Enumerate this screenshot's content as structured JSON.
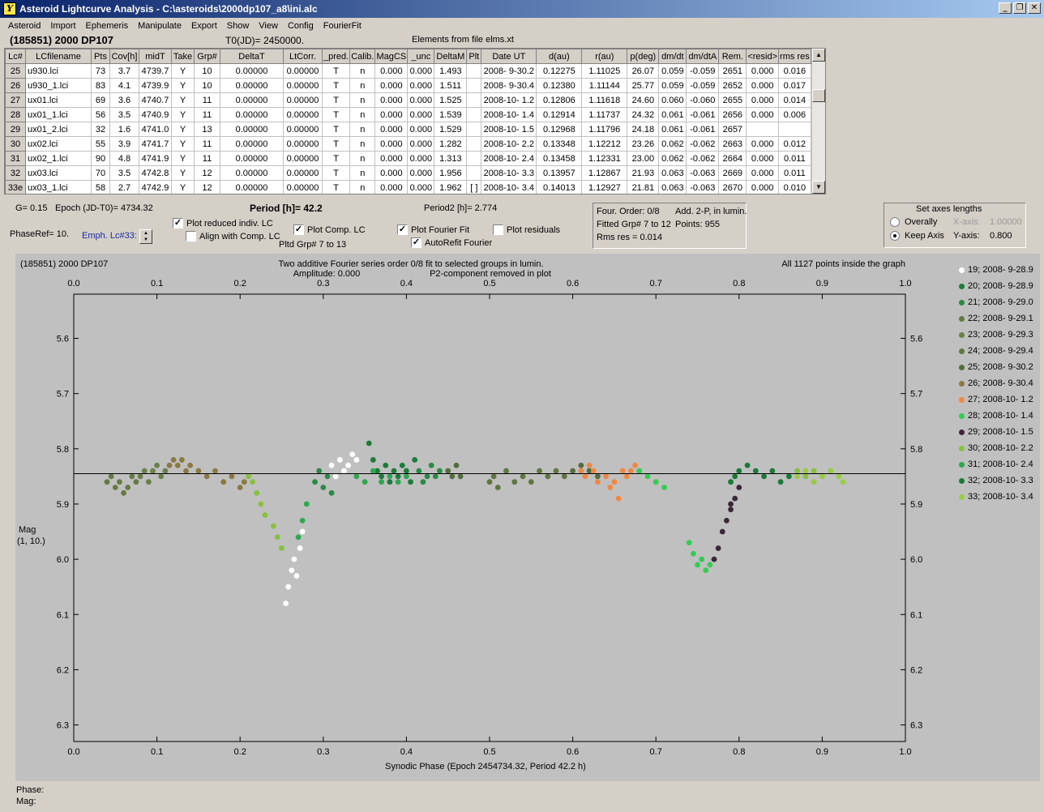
{
  "window": {
    "title": "Asteroid Lightcurve Analysis - C:\\asteroids\\2000dp107_a8\\ini.alc",
    "min_label": "_",
    "restore_label": "❐",
    "close_label": "✕"
  },
  "menu": [
    "Asteroid",
    "Import",
    "Ephemeris",
    "Manipulate",
    "Export",
    "Show",
    "View",
    "Config",
    "FourierFit"
  ],
  "header": {
    "object": "(185851) 2000 DP107",
    "t0": "T0(JD)= 2450000.",
    "elements": "Elements from file elms.xt"
  },
  "table": {
    "columns": [
      "Lc#",
      "LCfilename",
      "Pts",
      "Cov[h]",
      "midT",
      "Take",
      "Grp#",
      "DeltaT",
      "LtCorr.",
      "_pred.",
      "Calib.",
      "MagCS",
      "_unc",
      "DeltaM",
      "Plt",
      "Date UT",
      "d(au)",
      "r(au)",
      "p(deg)",
      "dm/dt",
      "dm/dtA",
      "Rem.",
      "<resid>",
      "rms res"
    ],
    "rows": [
      [
        "25",
        "u930.lci",
        "73",
        "3.7",
        "4739.7",
        "Y",
        "10",
        "0.00000",
        "0.00000",
        "T",
        "n",
        "0.000",
        "0.000",
        "1.493",
        "",
        "2008- 9-30.2",
        "0.12275",
        "1.11025",
        "26.07",
        "0.059",
        "-0.059",
        "2651",
        "0.000",
        "0.016"
      ],
      [
        "26",
        "u930_1.lci",
        "83",
        "4.1",
        "4739.9",
        "Y",
        "10",
        "0.00000",
        "0.00000",
        "T",
        "n",
        "0.000",
        "0.000",
        "1.511",
        "",
        "2008- 9-30.4",
        "0.12380",
        "1.11144",
        "25.77",
        "0.059",
        "-0.059",
        "2652",
        "0.000",
        "0.017"
      ],
      [
        "27",
        "ux01.lci",
        "69",
        "3.6",
        "4740.7",
        "Y",
        "11",
        "0.00000",
        "0.00000",
        "T",
        "n",
        "0.000",
        "0.000",
        "1.525",
        "",
        "2008-10- 1.2",
        "0.12806",
        "1.11618",
        "24.60",
        "0.060",
        "-0.060",
        "2655",
        "0.000",
        "0.014"
      ],
      [
        "28",
        "ux01_1.lci",
        "56",
        "3.5",
        "4740.9",
        "Y",
        "11",
        "0.00000",
        "0.00000",
        "T",
        "n",
        "0.000",
        "0.000",
        "1.539",
        "",
        "2008-10- 1.4",
        "0.12914",
        "1.11737",
        "24.32",
        "0.061",
        "-0.061",
        "2656",
        "0.000",
        "0.006"
      ],
      [
        "29",
        "ux01_2.lci",
        "32",
        "1.6",
        "4741.0",
        "Y",
        "13",
        "0.00000",
        "0.00000",
        "T",
        "n",
        "0.000",
        "0.000",
        "1.529",
        "",
        "2008-10- 1.5",
        "0.12968",
        "1.11796",
        "24.18",
        "0.061",
        "-0.061",
        "2657",
        "",
        ""
      ],
      [
        "30",
        "ux02.lci",
        "55",
        "3.9",
        "4741.7",
        "Y",
        "11",
        "0.00000",
        "0.00000",
        "T",
        "n",
        "0.000",
        "0.000",
        "1.282",
        "",
        "2008-10- 2.2",
        "0.13348",
        "1.12212",
        "23.26",
        "0.062",
        "-0.062",
        "2663",
        "0.000",
        "0.012"
      ],
      [
        "31",
        "ux02_1.lci",
        "90",
        "4.8",
        "4741.9",
        "Y",
        "11",
        "0.00000",
        "0.00000",
        "T",
        "n",
        "0.000",
        "0.000",
        "1.313",
        "",
        "2008-10- 2.4",
        "0.13458",
        "1.12331",
        "23.00",
        "0.062",
        "-0.062",
        "2664",
        "0.000",
        "0.011"
      ],
      [
        "32",
        "ux03.lci",
        "70",
        "3.5",
        "4742.8",
        "Y",
        "12",
        "0.00000",
        "0.00000",
        "T",
        "n",
        "0.000",
        "0.000",
        "1.956",
        "",
        "2008-10- 3.3",
        "0.13957",
        "1.12867",
        "21.93",
        "0.063",
        "-0.063",
        "2669",
        "0.000",
        "0.011"
      ],
      [
        "33e",
        "ux03_1.lci",
        "58",
        "2.7",
        "4742.9",
        "Y",
        "12",
        "0.00000",
        "0.00000",
        "T",
        "n",
        "0.000",
        "0.000",
        "1.962",
        "[ ]",
        "2008-10- 3.4",
        "0.14013",
        "1.12927",
        "21.81",
        "0.063",
        "-0.063",
        "2670",
        "0.000",
        "0.010"
      ]
    ]
  },
  "controls": {
    "g": "G= 0.15",
    "epoch": "Epoch (JD-T0)= 4734.32",
    "period": "Period [h]= 42.2",
    "period2": "Period2 [h]= 2.774",
    "phaseref": "PhaseRef= 10.",
    "emph": "Emph. Lc#33:",
    "plot_reduced": "Plot reduced indiv. LC",
    "align_comp": "Align with Comp. LC",
    "plot_comp": "Plot Comp. LC",
    "pltd_grp": "Pltd Grp#  7   to   13",
    "plot_fourier": "Plot Fourier Fit",
    "autorefit": "AutoRefit Fourier",
    "plot_residuals": "Plot residuals",
    "checked_mark": "✓",
    "four_order": "Four. Order:   0/8",
    "add_2p": "Add. 2-P, in lumin.",
    "fitted_grp": "Fitted Grp# 7 to 12",
    "points": "Points: 955",
    "rms_res": "Rms res     = 0.014",
    "axes_title": "Set axes lengths",
    "overally": "Overally",
    "keep_axis": "Keep Axis",
    "x_axis_label": "X-axis:",
    "x_axis_value": "1.00000",
    "y_axis_label": "Y-axis:",
    "y_axis_value": "0.800"
  },
  "plot": {
    "object": "(185851) 2000 DP107",
    "subtitle1": "Two additive Fourier series order 0/8 fit to selected groups in lumin.",
    "subtitle2": "Amplitude: 0.000",
    "subtitle3": "P2-component removed in plot",
    "points_inside": "All 1127 points inside the graph",
    "ylabel1": "Mag",
    "ylabel2": "(1, 10.)",
    "xlabel": "Synodic Phase (Epoch 2454734.32, Period 42.2 h)"
  },
  "chart_data": {
    "type": "scatter",
    "x_ticks": [
      "0.0",
      "0.1",
      "0.2",
      "0.3",
      "0.4",
      "0.5",
      "0.6",
      "0.7",
      "0.8",
      "0.9",
      "1.0"
    ],
    "y_ticks": [
      "5.6",
      "5.7",
      "5.8",
      "5.9",
      "6.0",
      "6.1",
      "6.2",
      "6.3"
    ],
    "xlim": [
      0.0,
      1.0
    ],
    "ylim": [
      6.33,
      5.52
    ],
    "fit_line_mag": 5.845,
    "series": [
      {
        "name": "19; 2008- 9-28.9",
        "color": "#ffffff",
        "points": [
          [
            0.255,
            6.08
          ],
          [
            0.258,
            6.05
          ],
          [
            0.262,
            6.02
          ],
          [
            0.265,
            6.0
          ],
          [
            0.268,
            6.03
          ],
          [
            0.272,
            5.98
          ],
          [
            0.275,
            5.95
          ],
          [
            0.32,
            5.82
          ],
          [
            0.325,
            5.84
          ],
          [
            0.33,
            5.83
          ],
          [
            0.335,
            5.81
          ],
          [
            0.31,
            5.83
          ],
          [
            0.315,
            5.85
          ],
          [
            0.34,
            5.82
          ]
        ]
      },
      {
        "name": "20; 2008- 9-28.9",
        "color": "#1e7b3a",
        "points": [
          [
            0.355,
            5.79
          ],
          [
            0.36,
            5.82
          ],
          [
            0.365,
            5.84
          ],
          [
            0.37,
            5.85
          ],
          [
            0.375,
            5.83
          ],
          [
            0.38,
            5.86
          ],
          [
            0.385,
            5.84
          ],
          [
            0.39,
            5.85
          ],
          [
            0.395,
            5.83
          ],
          [
            0.4,
            5.84
          ],
          [
            0.405,
            5.86
          ],
          [
            0.41,
            5.82
          ]
        ]
      },
      {
        "name": "21; 2008- 9-29.0",
        "color": "#2a8a46",
        "points": [
          [
            0.29,
            5.86
          ],
          [
            0.295,
            5.84
          ],
          [
            0.3,
            5.87
          ],
          [
            0.305,
            5.85
          ],
          [
            0.31,
            5.88
          ],
          [
            0.415,
            5.84
          ],
          [
            0.42,
            5.86
          ],
          [
            0.425,
            5.85
          ],
          [
            0.43,
            5.83
          ],
          [
            0.435,
            5.85
          ],
          [
            0.44,
            5.84
          ]
        ]
      },
      {
        "name": "22; 2008- 9-29.1",
        "color": "#667a44",
        "points": [
          [
            0.04,
            5.86
          ],
          [
            0.045,
            5.85
          ],
          [
            0.05,
            5.87
          ],
          [
            0.055,
            5.86
          ],
          [
            0.06,
            5.88
          ],
          [
            0.065,
            5.87
          ],
          [
            0.07,
            5.85
          ],
          [
            0.075,
            5.86
          ]
        ]
      },
      {
        "name": "23; 2008- 9-29.3",
        "color": "#6a8048",
        "points": [
          [
            0.08,
            5.85
          ],
          [
            0.085,
            5.84
          ],
          [
            0.09,
            5.86
          ],
          [
            0.095,
            5.84
          ],
          [
            0.1,
            5.83
          ],
          [
            0.105,
            5.85
          ],
          [
            0.11,
            5.84
          ]
        ]
      },
      {
        "name": "24; 2008- 9-29.4",
        "color": "#5e7640",
        "points": [
          [
            0.5,
            5.86
          ],
          [
            0.505,
            5.85
          ],
          [
            0.51,
            5.87
          ],
          [
            0.52,
            5.84
          ],
          [
            0.53,
            5.86
          ],
          [
            0.54,
            5.85
          ],
          [
            0.55,
            5.86
          ],
          [
            0.56,
            5.84
          ],
          [
            0.57,
            5.85
          ],
          [
            0.58,
            5.84
          ],
          [
            0.59,
            5.85
          ]
        ]
      },
      {
        "name": "25; 2008- 9-30.2",
        "color": "#526e3c",
        "points": [
          [
            0.45,
            5.84
          ],
          [
            0.455,
            5.85
          ],
          [
            0.46,
            5.83
          ],
          [
            0.465,
            5.85
          ],
          [
            0.6,
            5.84
          ],
          [
            0.61,
            5.83
          ],
          [
            0.62,
            5.84
          ],
          [
            0.63,
            5.85
          ]
        ]
      },
      {
        "name": "26; 2008- 9-30.4",
        "color": "#8a7a40",
        "points": [
          [
            0.115,
            5.83
          ],
          [
            0.12,
            5.82
          ],
          [
            0.125,
            5.83
          ],
          [
            0.13,
            5.82
          ],
          [
            0.135,
            5.84
          ],
          [
            0.14,
            5.83
          ],
          [
            0.15,
            5.84
          ],
          [
            0.16,
            5.85
          ],
          [
            0.17,
            5.84
          ],
          [
            0.18,
            5.86
          ],
          [
            0.19,
            5.85
          ],
          [
            0.2,
            5.87
          ],
          [
            0.205,
            5.86
          ]
        ]
      },
      {
        "name": "27; 2008-10- 1.2",
        "color": "#ee8844",
        "points": [
          [
            0.61,
            5.84
          ],
          [
            0.615,
            5.85
          ],
          [
            0.62,
            5.83
          ],
          [
            0.625,
            5.84
          ],
          [
            0.63,
            5.86
          ],
          [
            0.64,
            5.85
          ],
          [
            0.645,
            5.87
          ],
          [
            0.65,
            5.86
          ],
          [
            0.655,
            5.89
          ],
          [
            0.66,
            5.84
          ],
          [
            0.665,
            5.85
          ],
          [
            0.67,
            5.84
          ],
          [
            0.675,
            5.83
          ]
        ]
      },
      {
        "name": "28; 2008-10- 1.4",
        "color": "#33cc55",
        "points": [
          [
            0.74,
            5.97
          ],
          [
            0.745,
            5.99
          ],
          [
            0.75,
            6.01
          ],
          [
            0.755,
            6.0
          ],
          [
            0.76,
            6.02
          ],
          [
            0.765,
            6.01
          ],
          [
            0.77,
            6.0
          ],
          [
            0.68,
            5.84
          ],
          [
            0.69,
            5.85
          ],
          [
            0.7,
            5.86
          ],
          [
            0.71,
            5.87
          ]
        ]
      },
      {
        "name": "29; 2008-10- 1.5",
        "color": "#3a2838",
        "points": [
          [
            0.77,
            6.0
          ],
          [
            0.775,
            5.98
          ],
          [
            0.78,
            5.95
          ],
          [
            0.785,
            5.93
          ],
          [
            0.79,
            5.91
          ],
          [
            0.795,
            5.89
          ],
          [
            0.8,
            5.87
          ],
          [
            0.79,
            5.9
          ]
        ]
      },
      {
        "name": "30; 2008-10- 2.2",
        "color": "#88c040",
        "points": [
          [
            0.21,
            5.85
          ],
          [
            0.215,
            5.86
          ],
          [
            0.22,
            5.88
          ],
          [
            0.225,
            5.9
          ],
          [
            0.23,
            5.92
          ],
          [
            0.24,
            5.94
          ],
          [
            0.245,
            5.96
          ],
          [
            0.25,
            5.98
          ],
          [
            0.86,
            5.85
          ],
          [
            0.87,
            5.84
          ],
          [
            0.88,
            5.85
          ],
          [
            0.89,
            5.84
          ],
          [
            0.9,
            5.85
          ],
          [
            0.91,
            5.84
          ],
          [
            0.92,
            5.85
          ]
        ]
      },
      {
        "name": "31; 2008-10- 2.4",
        "color": "#2ea84e",
        "points": [
          [
            0.34,
            5.85
          ],
          [
            0.35,
            5.86
          ],
          [
            0.36,
            5.84
          ],
          [
            0.37,
            5.86
          ],
          [
            0.38,
            5.85
          ],
          [
            0.39,
            5.86
          ],
          [
            0.4,
            5.85
          ],
          [
            0.28,
            5.9
          ],
          [
            0.275,
            5.93
          ],
          [
            0.27,
            5.96
          ]
        ]
      },
      {
        "name": "32; 2008-10- 3.3",
        "color": "#1a7a38",
        "points": [
          [
            0.8,
            5.84
          ],
          [
            0.81,
            5.83
          ],
          [
            0.82,
            5.84
          ],
          [
            0.83,
            5.85
          ],
          [
            0.84,
            5.84
          ],
          [
            0.85,
            5.86
          ],
          [
            0.86,
            5.85
          ],
          [
            0.795,
            5.85
          ],
          [
            0.79,
            5.86
          ]
        ]
      },
      {
        "name": "33; 2008-10- 3.4",
        "color": "#99cc44",
        "points": [
          [
            0.87,
            5.85
          ],
          [
            0.88,
            5.84
          ],
          [
            0.89,
            5.86
          ],
          [
            0.9,
            5.85
          ],
          [
            0.91,
            5.84
          ],
          [
            0.92,
            5.85
          ],
          [
            0.925,
            5.86
          ]
        ]
      }
    ]
  },
  "footer": {
    "phase": "Phase:",
    "mag": "Mag:"
  }
}
